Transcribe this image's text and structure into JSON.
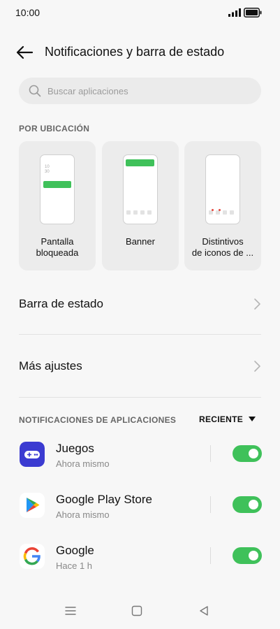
{
  "status_bar": {
    "time": "10:00"
  },
  "header": {
    "title": "Notificaciones y barra de estado"
  },
  "search": {
    "placeholder": "Buscar aplicaciones"
  },
  "location_section": {
    "label": "POR UBICACIÓN",
    "cards": [
      {
        "label": "Pantalla\nbloqueada",
        "preview_time": "10\n30"
      },
      {
        "label": "Banner"
      },
      {
        "label": "Distintivos\nde iconos de ..."
      }
    ]
  },
  "settings_rows": [
    {
      "label": "Barra de estado"
    },
    {
      "label": "Más ajustes"
    }
  ],
  "app_notifications": {
    "label": "NOTIFICACIONES DE APLICACIONES",
    "sort_label": "RECIENTE",
    "apps": [
      {
        "name": "Juegos",
        "time": "Ahora mismo",
        "enabled": true,
        "icon": "games-icon"
      },
      {
        "name": "Google Play Store",
        "time": "Ahora mismo",
        "enabled": true,
        "icon": "play-store-icon"
      },
      {
        "name": "Google",
        "time": "Hace 1 h",
        "enabled": true,
        "icon": "google-icon"
      }
    ]
  },
  "colors": {
    "accent_green": "#3fc15a",
    "games_icon_bg": "#3b3bd1"
  }
}
